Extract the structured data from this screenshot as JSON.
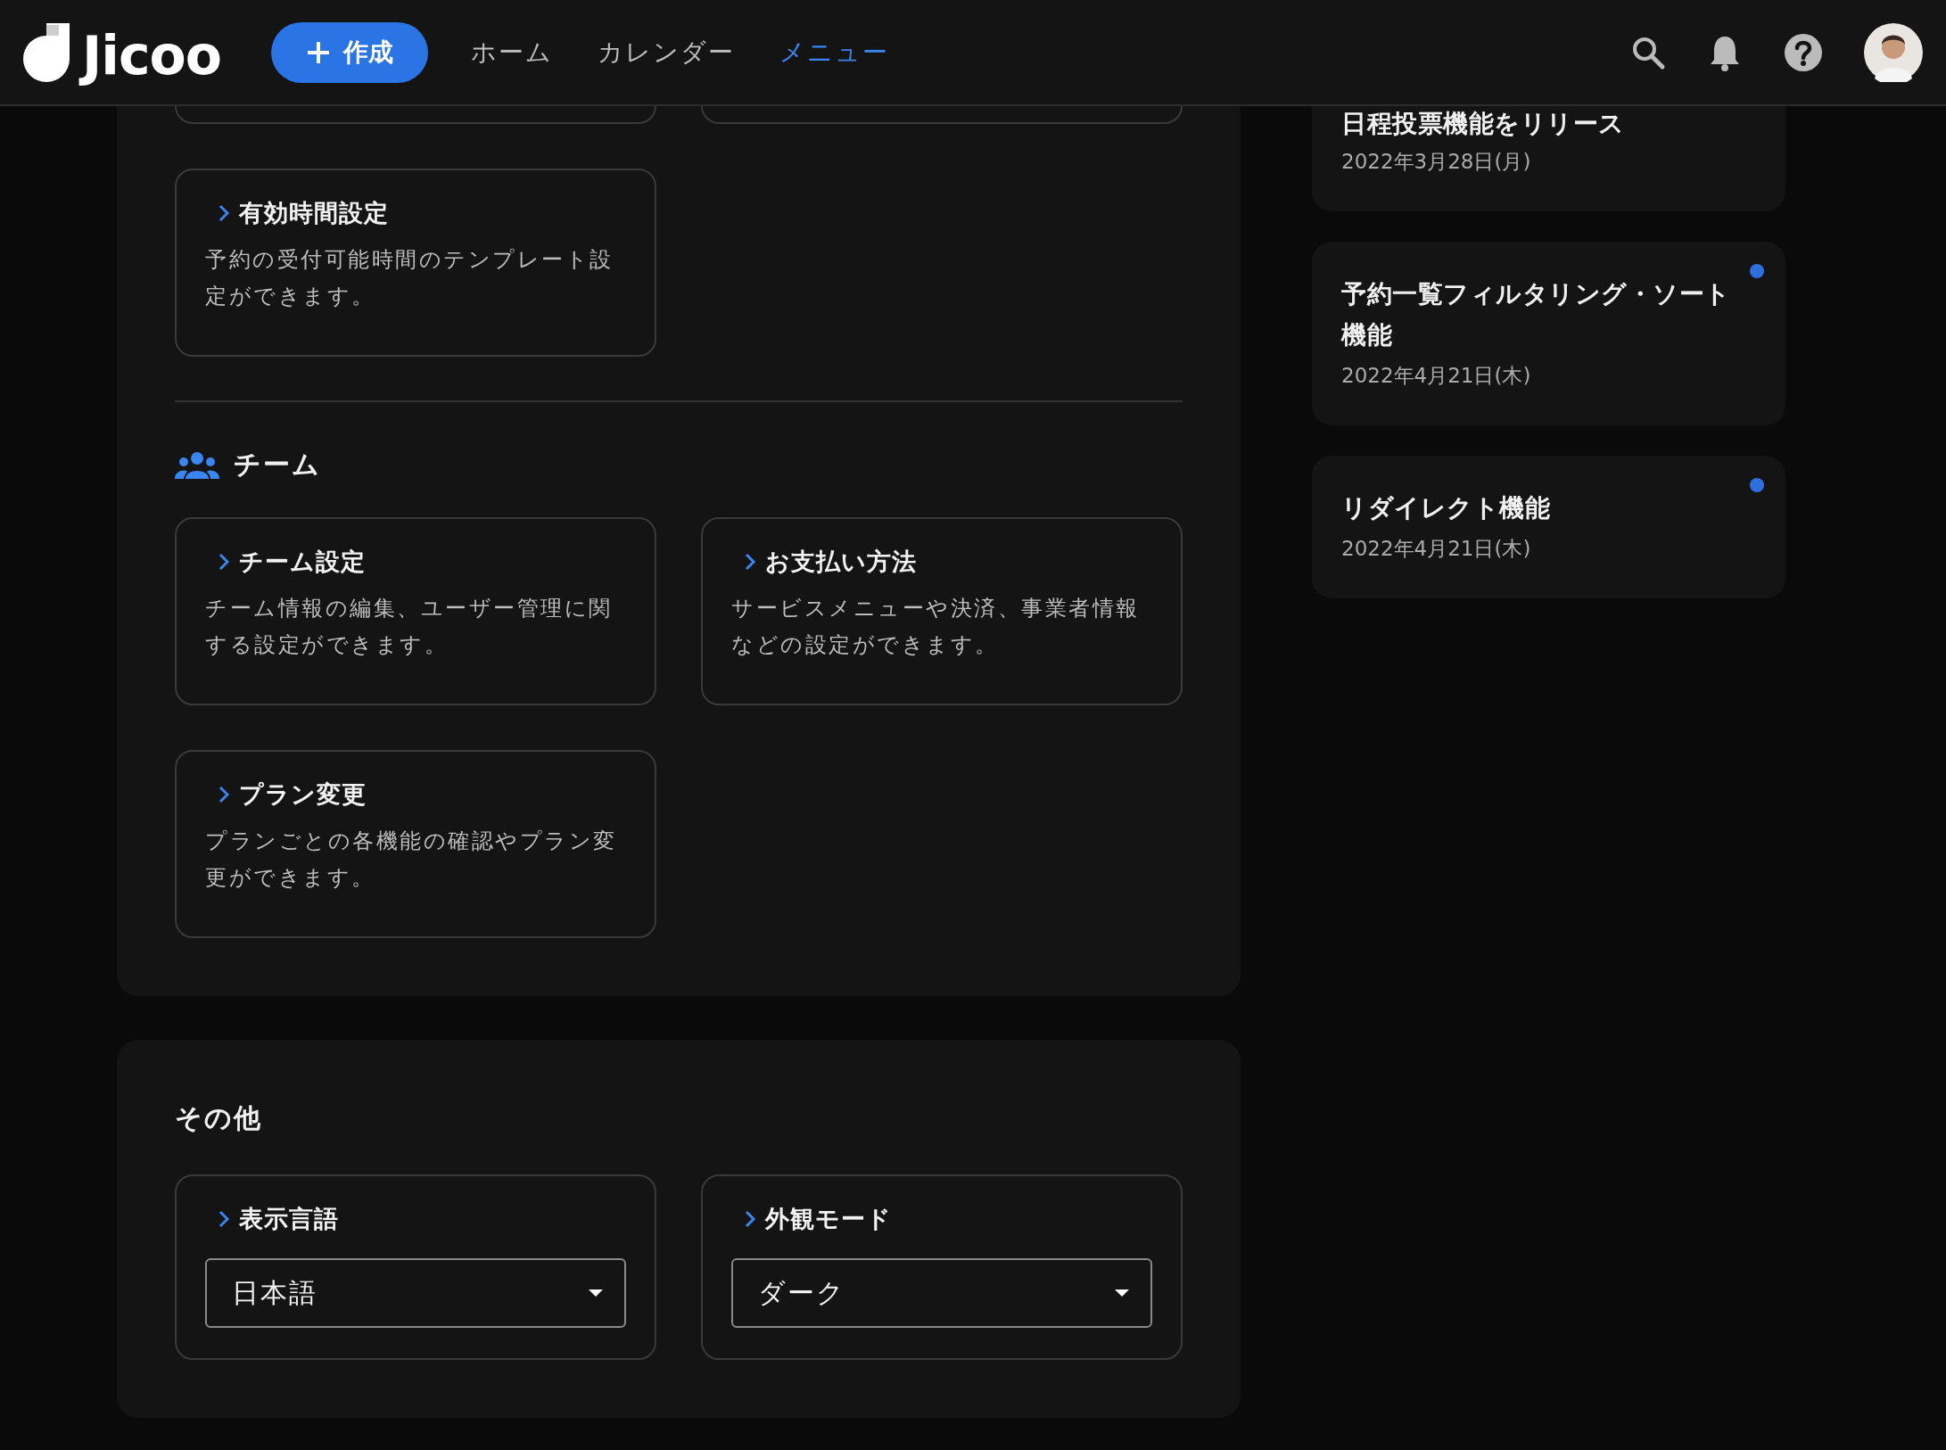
{
  "header": {
    "logo": "Jicoo",
    "create_button": "作成",
    "nav": [
      {
        "label": "ホーム",
        "selected": false
      },
      {
        "label": "カレンダー",
        "selected": false
      },
      {
        "label": "メニュー",
        "selected": true
      }
    ]
  },
  "settings": {
    "cards": [
      {
        "title": "有効時間設定",
        "description": "予約の受付可能時間のテンプレート設定ができます。"
      }
    ],
    "team": {
      "heading": "チーム",
      "cards": [
        {
          "title": "チーム設定",
          "description": "チーム情報の編集、ユーザー管理に関する設定ができます。"
        },
        {
          "title": "お支払い方法",
          "description": "サービスメニューや決済、事業者情報などの設定ができます。"
        },
        {
          "title": "プラン変更",
          "description": "プランごとの各機能の確認やプラン変更ができます。"
        }
      ]
    }
  },
  "other": {
    "heading": "その他",
    "selects": [
      {
        "label": "表示言語",
        "value": "日本語"
      },
      {
        "label": "外観モード",
        "value": "ダーク"
      }
    ]
  },
  "news": [
    {
      "title": "日程投票機能をリリース",
      "date": "2022年3月28日(月)"
    },
    {
      "title": "予約一覧フィルタリング・ソート機能",
      "date": "2022年4月21日(木)",
      "color": "#2f6fdf"
    },
    {
      "title": "リダイレクト機能",
      "date": "2022年4月21日(木)",
      "color": "#2f6fdf"
    }
  ]
}
